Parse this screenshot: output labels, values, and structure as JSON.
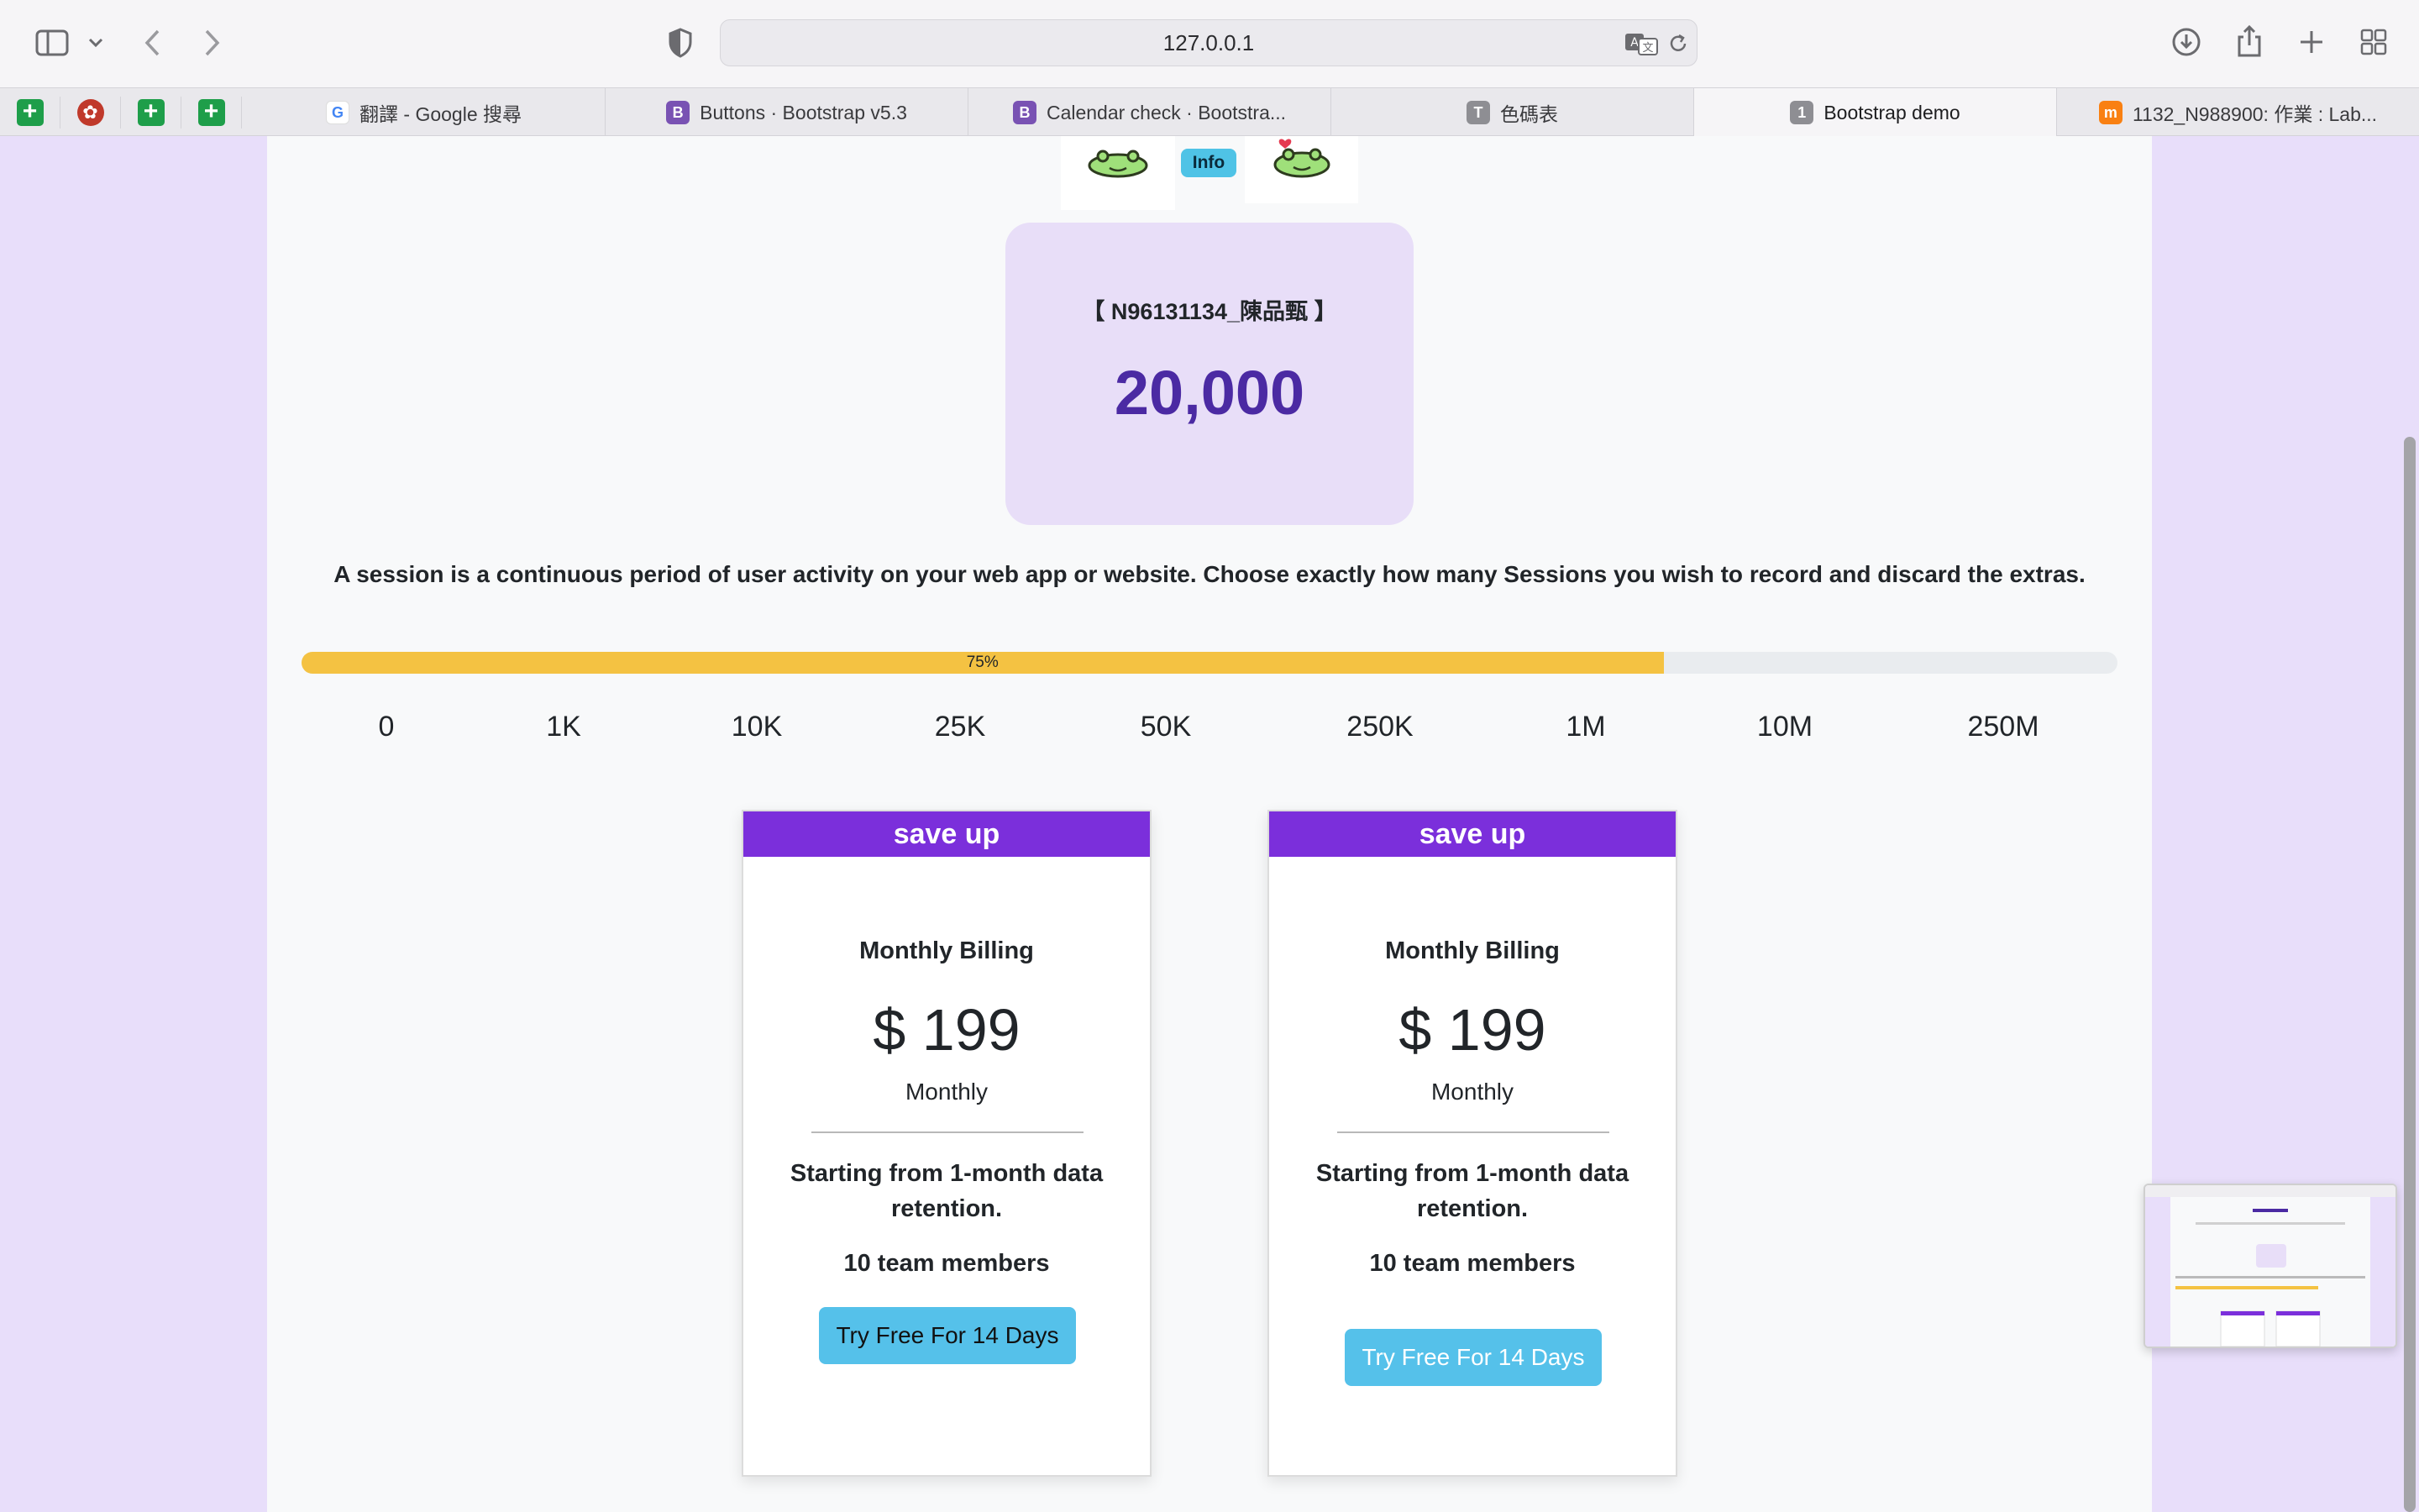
{
  "browser": {
    "url": "127.0.0.1",
    "tabs": [
      {
        "label": "翻譯 - Google 搜尋",
        "favicon": "G"
      },
      {
        "label": "Buttons · Bootstrap v5.3",
        "favicon": "B"
      },
      {
        "label": "Calendar check · Bootstra...",
        "favicon": "B"
      },
      {
        "label": "色碼表",
        "favicon": "T"
      },
      {
        "label": "Bootstrap demo",
        "favicon": "1",
        "active": true
      },
      {
        "label": "1132_N988900: 作業 : Lab...",
        "favicon": "m"
      }
    ]
  },
  "info_badge": "Info",
  "total": {
    "label": "【 N96131134_陳品甄 】",
    "value": "20,000"
  },
  "description": "A session is a continuous period of user activity on your web app or website. Choose exactly how many Sessions you wish to record and discard the extras.",
  "progress": {
    "percent": 75,
    "label": "75%",
    "color": "#f4c242"
  },
  "ticks": [
    "0",
    "1K",
    "10K",
    "25K",
    "50K",
    "250K",
    "1M",
    "10M",
    "250M"
  ],
  "pricing_cards": [
    {
      "header": "save up",
      "billing": "Monthly Billing",
      "price": "$ 199",
      "period": "Monthly",
      "retention": "Starting from 1-month data retention.",
      "team": "10 team members",
      "button": "Try Free For 14 Days"
    },
    {
      "header": "save up",
      "billing": "Monthly Billing",
      "price": "$ 199",
      "period": "Monthly",
      "retention": "Starting from 1-month data retention.",
      "team": "10 team members",
      "button": "Try Free For 14 Days"
    }
  ],
  "colors": {
    "accent_purple": "#7b2fdb",
    "value_purple": "#4b2aa3",
    "button_cyan": "#55c1ea",
    "page_bg": "#e8defa"
  }
}
